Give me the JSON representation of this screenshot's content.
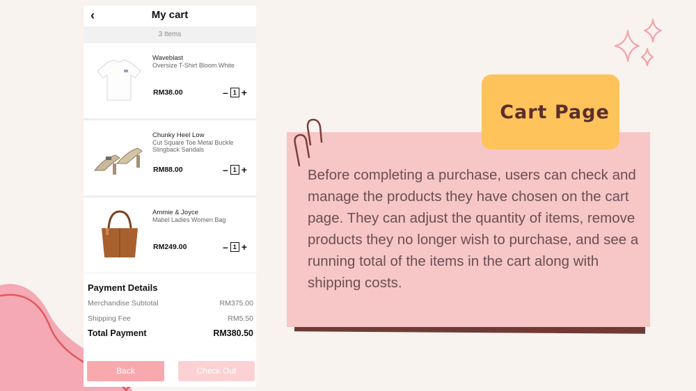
{
  "phone": {
    "title": "My cart",
    "items_count": "3 Items",
    "items": [
      {
        "brand": "Waveblast",
        "name": "Oversize T-Shirt Bloom White",
        "price": "RM38.00",
        "qty": "1"
      },
      {
        "brand": "Chunky Heel Low",
        "name": "Cut Square Toe Metal Buckle Slingback Sandals",
        "price": "RM88.00",
        "qty": "1"
      },
      {
        "brand": "Ammie & Joyce",
        "name": "Mabel Ladies Women Bag",
        "price": "RM249.00",
        "qty": "1"
      }
    ],
    "payment": {
      "title": "Payment Details",
      "subtotal_label": "Merchandise Subtotal",
      "subtotal_value": "RM375.00",
      "shipping_label": "Shipping Fee",
      "shipping_value": "RM5.50",
      "total_label": "Total Payment",
      "total_value": "RM380.50"
    },
    "buttons": {
      "back": "Back",
      "checkout": "Check Out"
    },
    "icons": {
      "back": "chevron-left-icon",
      "minus": "minus-icon",
      "plus": "plus-icon"
    }
  },
  "card": {
    "tag": "Cart Page",
    "description": "Before completing a purchase, users can check and manage the products they have chosen on the cart page. They can adjust the quantity of items, remove products they no longer wish to purchase, and see a running total of the items in the cart along with shipping costs."
  },
  "colors": {
    "background": "#f8f3ee",
    "note": "#f7c6c7",
    "tag": "#fec35b",
    "tag_text": "#5a2f2a",
    "back_button": "#f8a9ae",
    "checkout_button": "#fcd1d3"
  }
}
